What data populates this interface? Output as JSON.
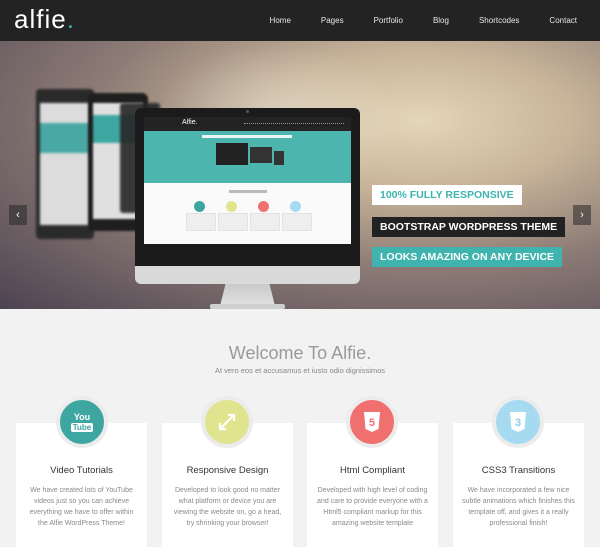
{
  "header": {
    "logo": "alfie",
    "logo_dot": ".",
    "nav": [
      "Home",
      "Pages",
      "Portfolio",
      "Blog",
      "Shortcodes",
      "Contact"
    ]
  },
  "hero": {
    "slider_prev": "‹",
    "slider_next": "›",
    "taglines": [
      "100% FULLY RESPONSIVE",
      "BOOTSTRAP WORDPRESS THEME",
      "LOOKS AMAZING ON ANY DEVICE"
    ],
    "monitor_logo": "Alfie."
  },
  "welcome": {
    "title": "Welcome To Alfie.",
    "subtitle": "At vero eos et accusamus et iusto odio dignissimos"
  },
  "features": [
    {
      "title": "Video Tutorials",
      "icon": "youtube-icon",
      "color": "#3ea6a1",
      "icon_text": "You Tube",
      "desc": "We have created lots of YouTube videos just so you can achieve everything we have to offer within the Alfie WordPress Theme!"
    },
    {
      "title": "Responsive Design",
      "icon": "resize-arrows-icon",
      "color": "#e1e48f",
      "icon_text": "",
      "desc": "Developed to look good no matter what platform or device you are viewing the website on, go a head, try shrinking your browser!"
    },
    {
      "title": "Html Compliant",
      "icon": "html5-icon",
      "color": "#f07070",
      "icon_text": "5",
      "desc": "Developed with high level of coding and care to provide everyone with a Html5 compliant markup for this amazing website template"
    },
    {
      "title": "CSS3 Transitions",
      "icon": "css3-icon",
      "color": "#a6daf0",
      "icon_text": "3",
      "desc": "We have incorporated a few nice subtle animations which finishes this template off, and gives it a really professional finish!"
    }
  ]
}
